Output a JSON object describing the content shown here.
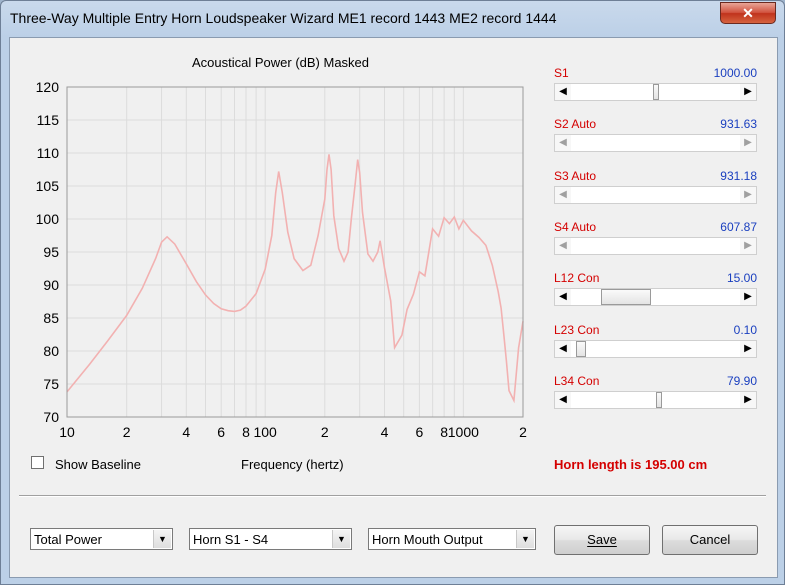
{
  "window": {
    "title": "Three-Way Multiple Entry Horn Loudspeaker Wizard    ME1 record 1443    ME2 record 1444",
    "close_glyph": "✕"
  },
  "chart": {
    "title": "Acoustical Power (dB)   Masked",
    "x_axis_label": "Frequency (hertz)"
  },
  "chart_data": {
    "type": "line",
    "title": "Acoustical Power (dB)   Masked",
    "xlabel": "Frequency (hertz)",
    "ylabel": "",
    "x_scale": "log",
    "xlim": [
      10,
      2000
    ],
    "ylim": [
      70,
      120
    ],
    "x_tick_labels": [
      "10",
      "2",
      "4",
      "6",
      "8",
      "100",
      "2",
      "4",
      "6",
      "8",
      "1000",
      "2"
    ],
    "y_tick_labels": [
      "120",
      "115",
      "110",
      "105",
      "100",
      "95",
      "90",
      "85",
      "80",
      "75",
      "70"
    ],
    "grid": true,
    "line_color": "#f2b1b1",
    "series": [
      {
        "x": [
          10,
          13,
          16,
          20,
          24,
          28,
          30,
          32,
          35,
          40,
          45,
          50,
          55,
          60,
          65,
          70,
          75,
          80,
          90,
          100,
          108,
          113,
          117,
          122,
          130,
          140,
          155,
          170,
          185,
          200,
          205,
          210,
          215,
          222,
          235,
          250,
          262,
          272,
          285,
          293,
          300,
          310,
          330,
          350,
          370,
          380,
          400,
          430,
          450,
          490,
          520,
          560,
          600,
          640,
          700,
          750,
          800,
          850,
          900,
          950,
          1000,
          1100,
          1200,
          1300,
          1400,
          1500,
          1550,
          1600,
          1650,
          1700,
          1800,
          1900,
          2000
        ],
        "y": [
          73.8,
          78,
          81.5,
          85.4,
          89.5,
          94,
          96.5,
          97.3,
          96.2,
          93.2,
          90.5,
          88.5,
          87.2,
          86.4,
          86.1,
          86,
          86.2,
          86.8,
          88.7,
          92.4,
          97.5,
          104,
          107.2,
          104,
          98,
          94,
          92.2,
          93,
          97.5,
          103,
          107.5,
          109.8,
          107.5,
          100.5,
          95.5,
          93.6,
          95,
          100,
          105.5,
          109,
          107,
          101,
          94.7,
          93.6,
          95,
          96.7,
          92.6,
          87.6,
          80.5,
          82.4,
          86.3,
          88.6,
          92,
          91.4,
          98.5,
          97.4,
          100.2,
          99.3,
          100.3,
          98.5,
          99.8,
          98.2,
          97.2,
          96,
          93,
          89,
          86.5,
          82.5,
          78.5,
          74,
          72.5,
          80.5,
          84.5
        ]
      }
    ]
  },
  "sliders": [
    {
      "label": "S1",
      "value": "1000.00"
    },
    {
      "label": "S2  Auto",
      "value": "931.63"
    },
    {
      "label": "S3  Auto",
      "value": "931.18"
    },
    {
      "label": "S4  Auto",
      "value": "607.87"
    },
    {
      "label": "L12  Con",
      "value": "15.00"
    },
    {
      "label": "L23  Con",
      "value": "0.10"
    },
    {
      "label": "L34  Con",
      "value": "79.90"
    }
  ],
  "slider_levels": {
    "s1": 0.5,
    "l12": 0.25,
    "l23": 0.03,
    "l34": 0.52
  },
  "show_baseline_label": "Show Baseline",
  "horn_length_text": "Horn length is 195.00 cm",
  "combos": {
    "power": "Total Power",
    "horn": "Horn S1 - S4",
    "output": "Horn Mouth Output"
  },
  "buttons": {
    "save": "Save",
    "cancel": "Cancel"
  }
}
